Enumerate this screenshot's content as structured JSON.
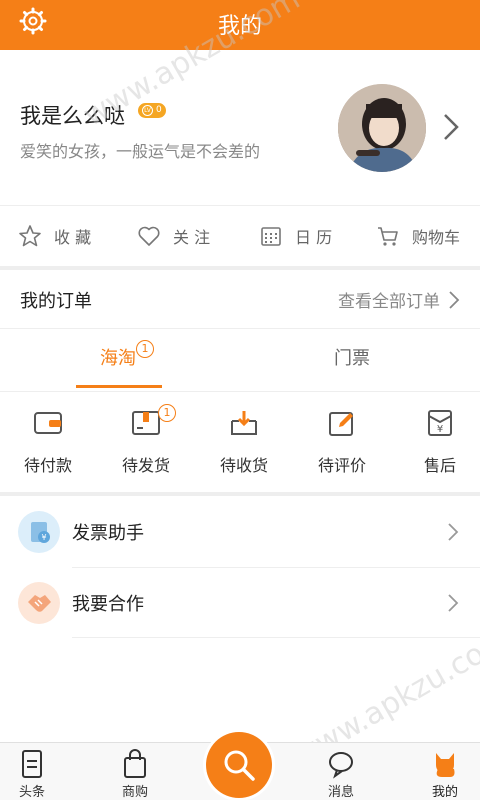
{
  "header": {
    "title": "我的"
  },
  "profile": {
    "name": "我是么么哒",
    "level_badge": "LV",
    "level_value": "0",
    "motto": "爱笑的女孩，一般运气是不会差的"
  },
  "quick_actions": [
    {
      "icon": "star-icon",
      "label": "收  藏"
    },
    {
      "icon": "heart-icon",
      "label": "关  注"
    },
    {
      "icon": "calendar-icon",
      "label": "日  历"
    },
    {
      "icon": "cart-icon",
      "label": "购物车"
    }
  ],
  "orders": {
    "label": "我的订单",
    "view_all": "查看全部订单"
  },
  "tabs": [
    {
      "label": "海淘",
      "badge": "1",
      "active": true
    },
    {
      "label": "门票",
      "active": false
    }
  ],
  "order_status": [
    {
      "icon": "wallet-icon",
      "label": "待付款"
    },
    {
      "icon": "package-icon",
      "label": "待发货",
      "badge": "1"
    },
    {
      "icon": "inbox-icon",
      "label": "待收货"
    },
    {
      "icon": "edit-icon",
      "label": "待评价"
    },
    {
      "icon": "refund-icon",
      "label": "售后"
    }
  ],
  "menu": [
    {
      "icon": "invoice-icon",
      "label": "发票助手"
    },
    {
      "icon": "handshake-icon",
      "label": "我要合作"
    }
  ],
  "bottom_nav": [
    {
      "icon": "news-icon",
      "label": "头条"
    },
    {
      "icon": "shopping-bag-icon",
      "label": "商购"
    },
    {
      "icon": "search-icon",
      "label": ""
    },
    {
      "icon": "message-icon",
      "label": "消息"
    },
    {
      "icon": "cat-icon",
      "label": "我的",
      "active": true
    }
  ],
  "watermark": "www.apkzu.com",
  "colors": {
    "accent": "#f57f17",
    "divider": "#eeeeee"
  }
}
